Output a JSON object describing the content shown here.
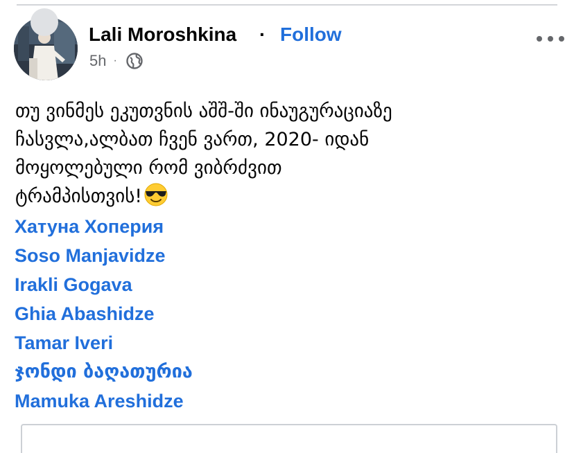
{
  "post": {
    "author": "Lali Moroshkina",
    "separator": "·",
    "follow_label": "Follow",
    "time": "5h",
    "meta_separator": "·",
    "audience_icon": "globe-icon",
    "more_icon": "more-horizontal-icon",
    "text_lines": [
      "თუ ვინმეს ეკუთვნის აშშ-ში ინაუგურაციაზე",
      "ჩასვლა,ალბათ ჩვენ ვართ, 2020- იდან",
      "მოყოლებული რომ ვიბრძვით",
      "ტრამპისთვის!"
    ],
    "emoji": "smiling-face-with-sunglasses-icon",
    "mentions": [
      "Хатуна Хоперия",
      "Soso Manjavidze",
      "Irakli Gogava",
      "Ghia Abashidze",
      "Tamar Iveri",
      "ჯონდი ბაღათურია",
      "Mamuka Areshidze"
    ]
  },
  "colors": {
    "link_blue": "#216fdb",
    "text": "#050505",
    "secondary_text": "#65676b",
    "divider": "#d3d5d9"
  }
}
